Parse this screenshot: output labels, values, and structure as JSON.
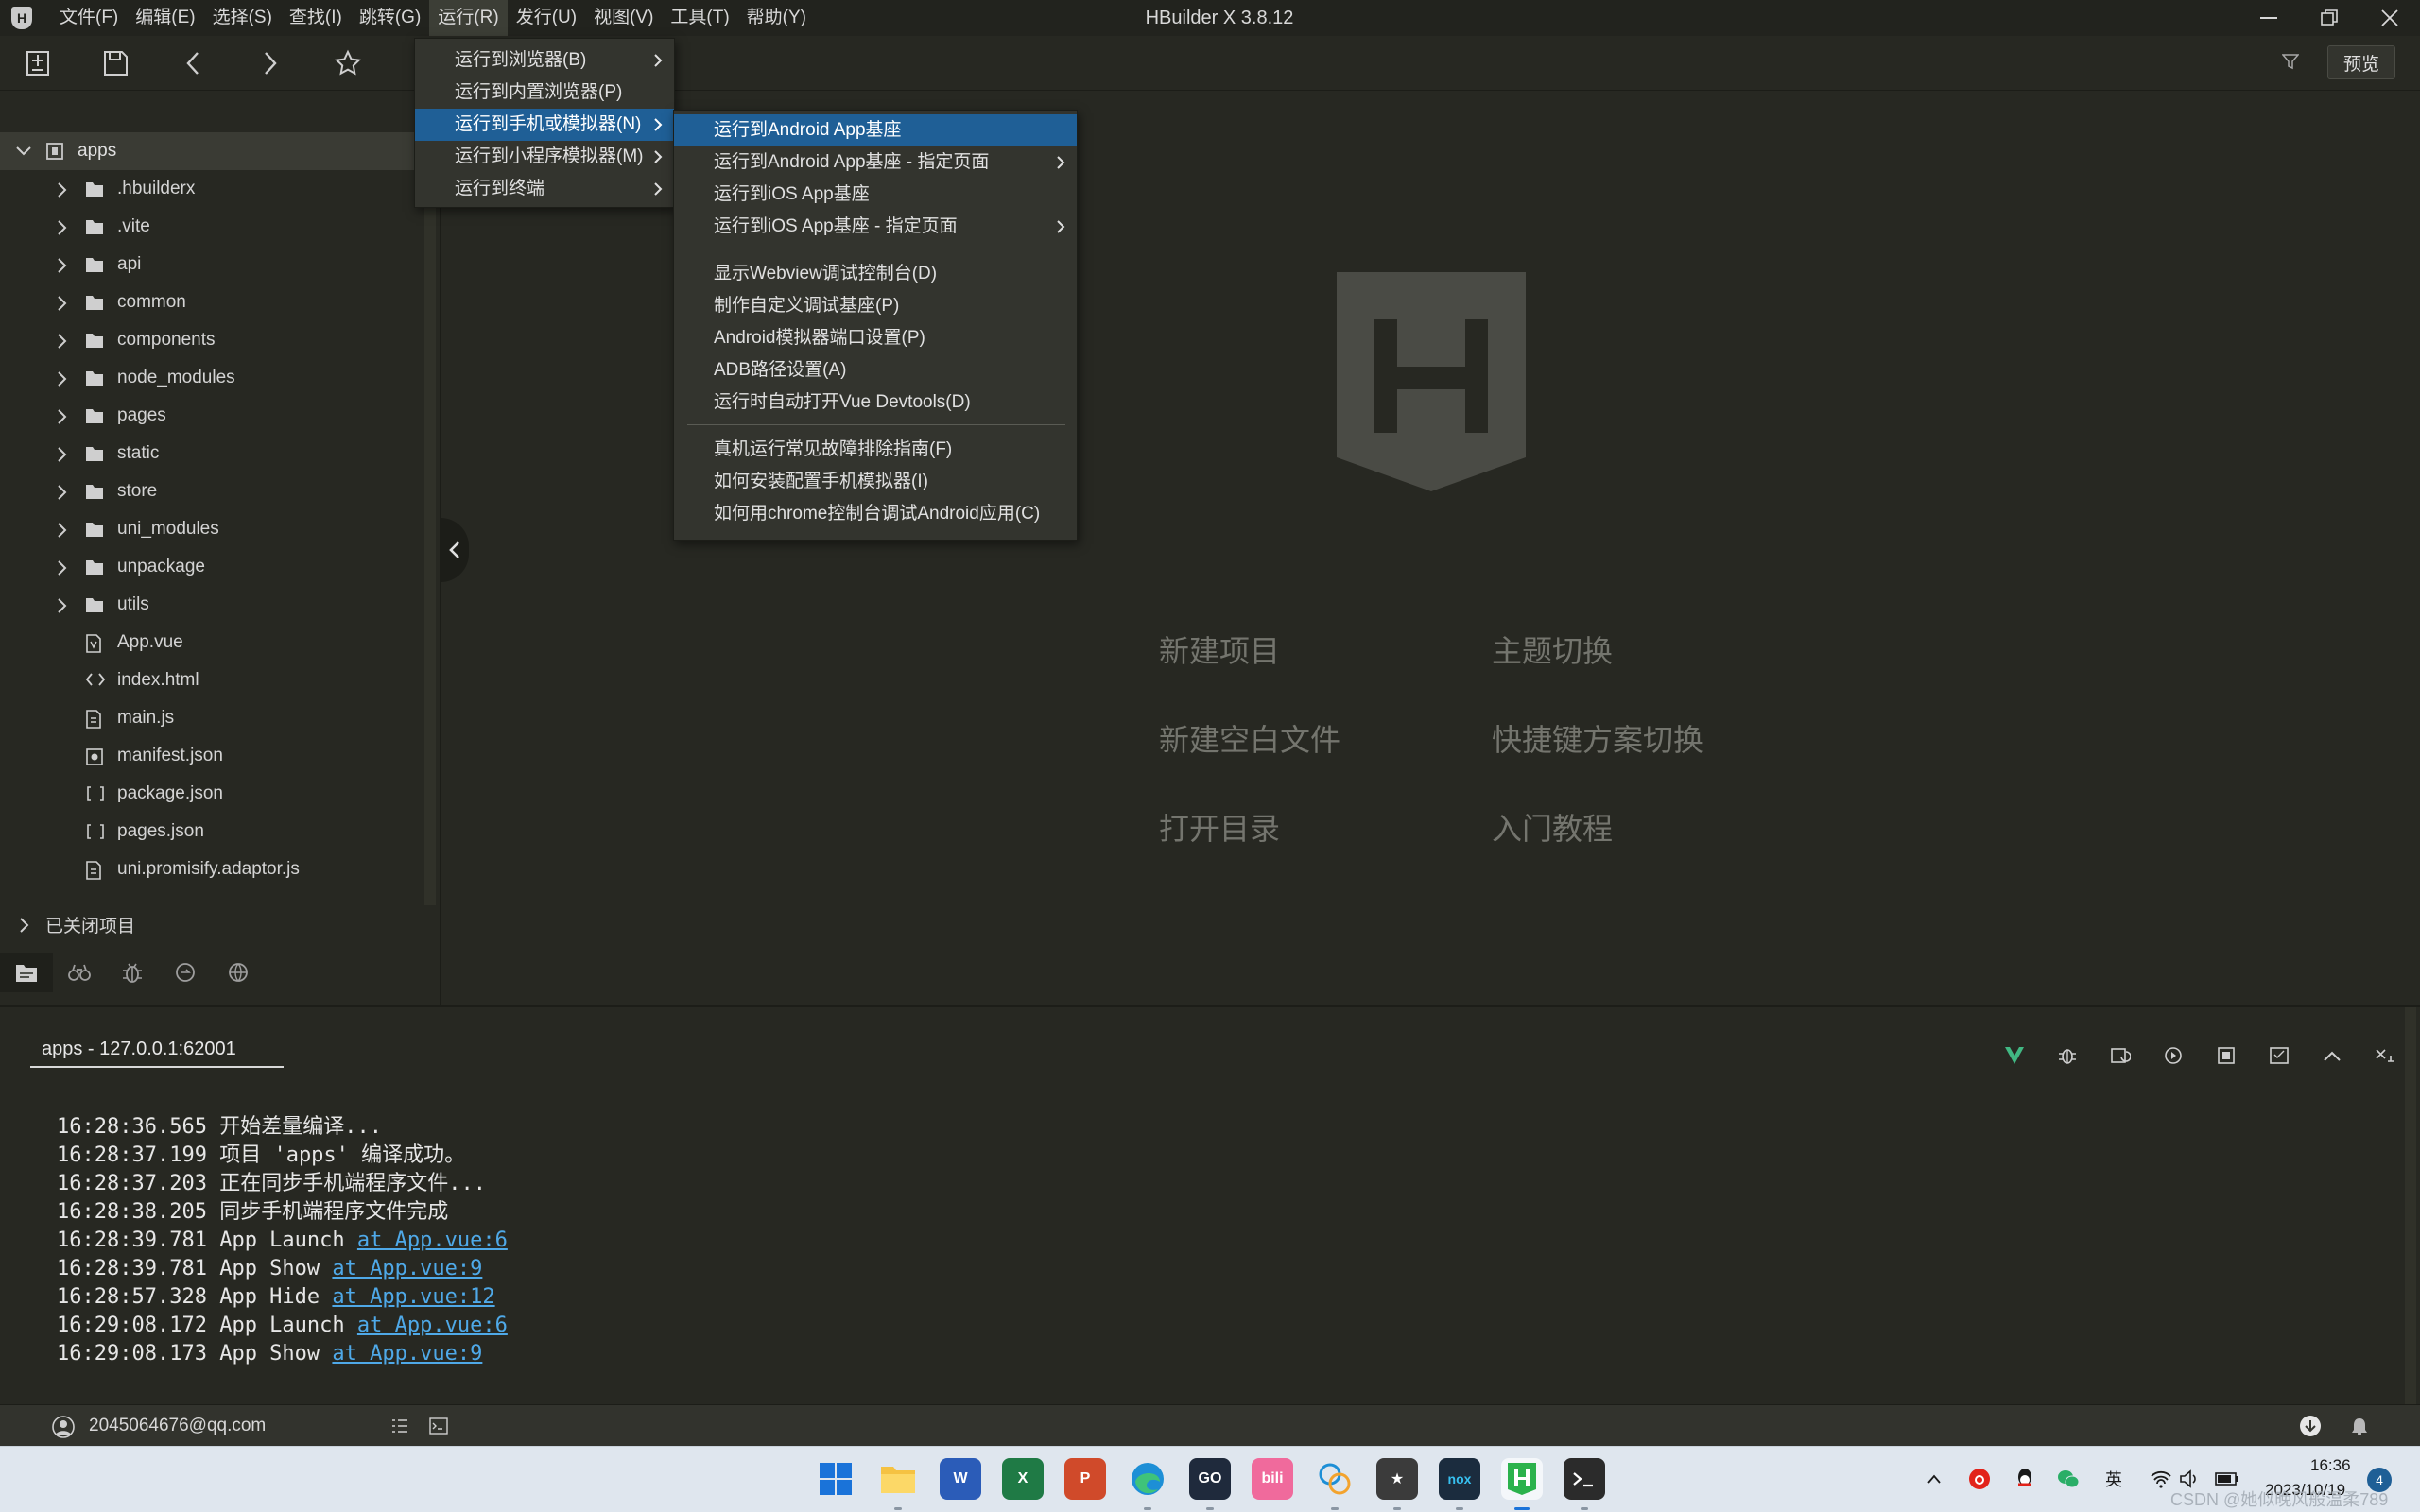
{
  "titlebar": {
    "window_title": "HBuilder X 3.8.12",
    "logo": "hbuilder-logo",
    "menus": [
      {
        "label": "文件(F)"
      },
      {
        "label": "编辑(E)"
      },
      {
        "label": "选择(S)"
      },
      {
        "label": "查找(I)"
      },
      {
        "label": "跳转(G)"
      },
      {
        "label": "运行(R)"
      },
      {
        "label": "发行(U)"
      },
      {
        "label": "视图(V)"
      },
      {
        "label": "工具(T)"
      },
      {
        "label": "帮助(Y)"
      }
    ]
  },
  "toolbar": {
    "preview_label": "预览",
    "icons": [
      "new-file-icon",
      "save-icon",
      "back-icon",
      "forward-icon",
      "star-icon",
      "filter-icon"
    ]
  },
  "sidebar": {
    "project": "apps",
    "items": [
      {
        "label": ".hbuilderx",
        "type": "folder"
      },
      {
        "label": ".vite",
        "type": "folder"
      },
      {
        "label": "api",
        "type": "folder"
      },
      {
        "label": "common",
        "type": "folder"
      },
      {
        "label": "components",
        "type": "folder"
      },
      {
        "label": "node_modules",
        "type": "folder"
      },
      {
        "label": "pages",
        "type": "folder"
      },
      {
        "label": "static",
        "type": "folder"
      },
      {
        "label": "store",
        "type": "folder"
      },
      {
        "label": "uni_modules",
        "type": "folder"
      },
      {
        "label": "unpackage",
        "type": "folder"
      },
      {
        "label": "utils",
        "type": "folder"
      },
      {
        "label": "App.vue",
        "type": "vue"
      },
      {
        "label": "index.html",
        "type": "html"
      },
      {
        "label": "main.js",
        "type": "js"
      },
      {
        "label": "manifest.json",
        "type": "manifest"
      },
      {
        "label": "package.json",
        "type": "json"
      },
      {
        "label": "pages.json",
        "type": "json"
      },
      {
        "label": "uni.promisify.adaptor.js",
        "type": "js"
      }
    ],
    "closed_projects": "已关闭项目"
  },
  "run_menu": {
    "items": [
      {
        "label": "运行到浏览器(B)",
        "submenu": true
      },
      {
        "label": "运行到内置浏览器(P)",
        "submenu": false
      },
      {
        "label": "运行到手机或模拟器(N)",
        "submenu": true,
        "highlighted": true
      },
      {
        "label": "运行到小程序模拟器(M)",
        "submenu": true
      },
      {
        "label": "运行到终端",
        "submenu": true
      }
    ]
  },
  "submenu": {
    "groups": [
      [
        {
          "label": "运行到Android App基座",
          "submenu": false,
          "highlighted": true
        },
        {
          "label": "运行到Android App基座 - 指定页面",
          "submenu": true
        },
        {
          "label": "运行到iOS App基座",
          "submenu": false
        },
        {
          "label": "运行到iOS App基座 - 指定页面",
          "submenu": true
        }
      ],
      [
        {
          "label": "显示Webview调试控制台(D)"
        },
        {
          "label": "制作自定义调试基座(P)"
        },
        {
          "label": "Android模拟器端口设置(P)"
        },
        {
          "label": "ADB路径设置(A)"
        },
        {
          "label": "运行时自动打开Vue Devtools(D)"
        }
      ],
      [
        {
          "label": "真机运行常见故障排除指南(F)"
        },
        {
          "label": "如何安装配置手机模拟器(I)"
        },
        {
          "label": "如何用chrome控制台调试Android应用(C)"
        }
      ]
    ]
  },
  "welcome": {
    "links": [
      "新建项目",
      "主题切换",
      "新建空白文件",
      "快捷键方案切换",
      "打开目录",
      "入门教程"
    ]
  },
  "console": {
    "tab_label": "apps - 127.0.0.1:62001",
    "lines": [
      {
        "time": "16:28:36.565",
        "text": "开始差量编译...",
        "link": ""
      },
      {
        "time": "16:28:37.199",
        "text": "项目 'apps' 编译成功。",
        "link": ""
      },
      {
        "time": "16:28:37.203",
        "text": "正在同步手机端程序文件...",
        "link": ""
      },
      {
        "time": "16:28:38.205",
        "text": "同步手机端程序文件完成",
        "link": ""
      },
      {
        "time": "16:28:39.781",
        "text": "App Launch",
        "link": "at App.vue:6"
      },
      {
        "time": "16:28:39.781",
        "text": "App Show",
        "link": "at App.vue:9"
      },
      {
        "time": "16:28:57.328",
        "text": "App Hide",
        "link": "at App.vue:12"
      },
      {
        "time": "16:29:08.172",
        "text": "App Launch",
        "link": "at App.vue:6"
      },
      {
        "time": "16:29:08.173",
        "text": "App Show",
        "link": "at App.vue:9"
      }
    ]
  },
  "statusbar": {
    "user_email": "2045064676@qq.com"
  },
  "taskbar": {
    "apps": [
      "windows-start",
      "file-explorer",
      "word",
      "excel",
      "powerpoint",
      "edge",
      "goland",
      "bilibili",
      "photos",
      "game",
      "nox",
      "hbuilderx",
      "terminal"
    ],
    "tray_ime": "英",
    "time": "16:36",
    "date": "2023/10/19",
    "notification_count": "4",
    "watermark": "CSDN @她似晚风般温柔789"
  },
  "colors": {
    "accent": "#1f5f96",
    "background": "#272822",
    "link": "#4fa9e8"
  }
}
